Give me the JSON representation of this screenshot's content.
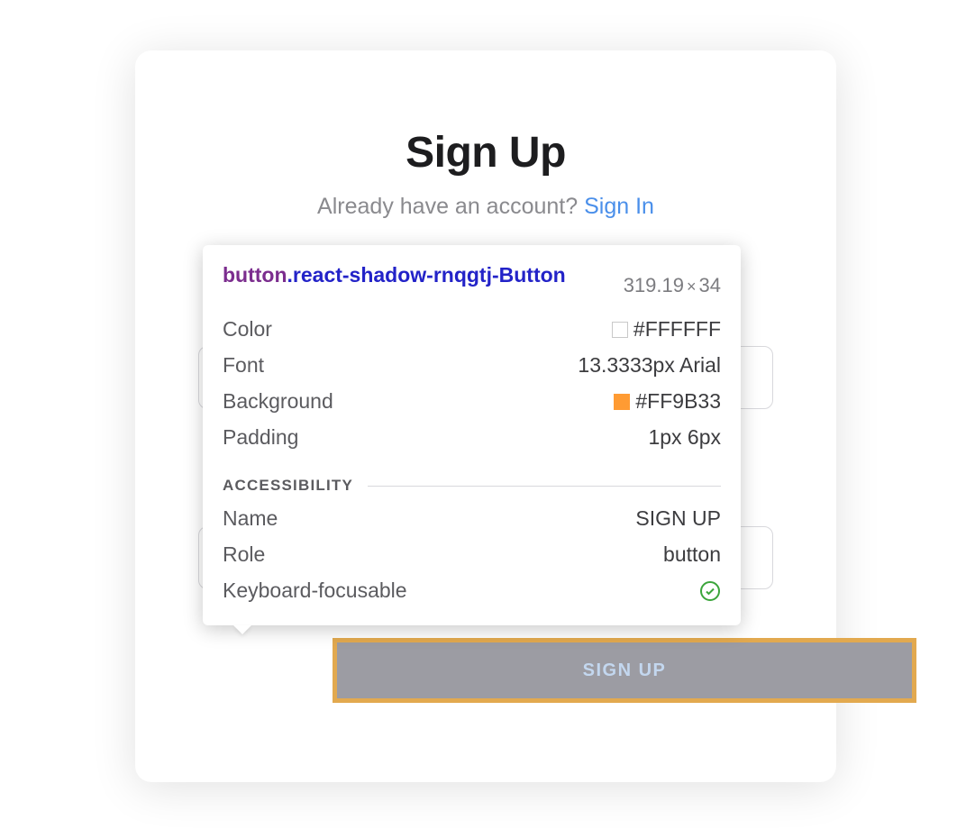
{
  "card": {
    "title": "Sign Up",
    "subtitle_text": "Already have an account? ",
    "signin_link": "Sign In",
    "button_label": "SIGN UP"
  },
  "tooltip": {
    "selector_tag": "button",
    "selector_class": ".react-shadow-rnqgtj-Button",
    "dimensions_w": "319.19",
    "dimensions_h": "34",
    "props": {
      "color_label": "Color",
      "color_value": "#FFFFFF",
      "font_label": "Font",
      "font_value": "13.3333px Arial",
      "bg_label": "Background",
      "bg_value": "#FF9B33",
      "padding_label": "Padding",
      "padding_value": "1px 6px"
    },
    "accessibility_heading": "ACCESSIBILITY",
    "a11y": {
      "name_label": "Name",
      "name_value": "SIGN UP",
      "role_label": "Role",
      "role_value": "button",
      "kf_label": "Keyboard-focusable"
    }
  }
}
